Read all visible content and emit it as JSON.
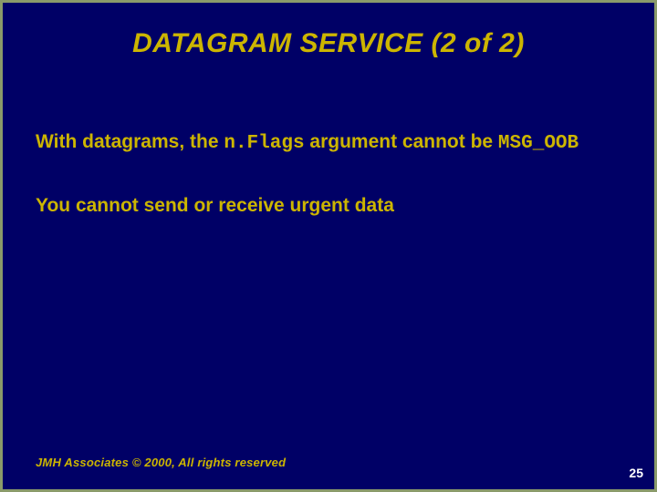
{
  "slide": {
    "title": "DATAGRAM SERVICE (2 of 2)",
    "para1_a": "With datagrams, the ",
    "para1_code1": "n.Flags",
    "para1_b": " argument cannot be ",
    "para1_code2": "MSG_OOB",
    "para2": "You cannot send or receive urgent data",
    "footer": "JMH Associates © 2000, All rights reserved",
    "page": "25"
  }
}
